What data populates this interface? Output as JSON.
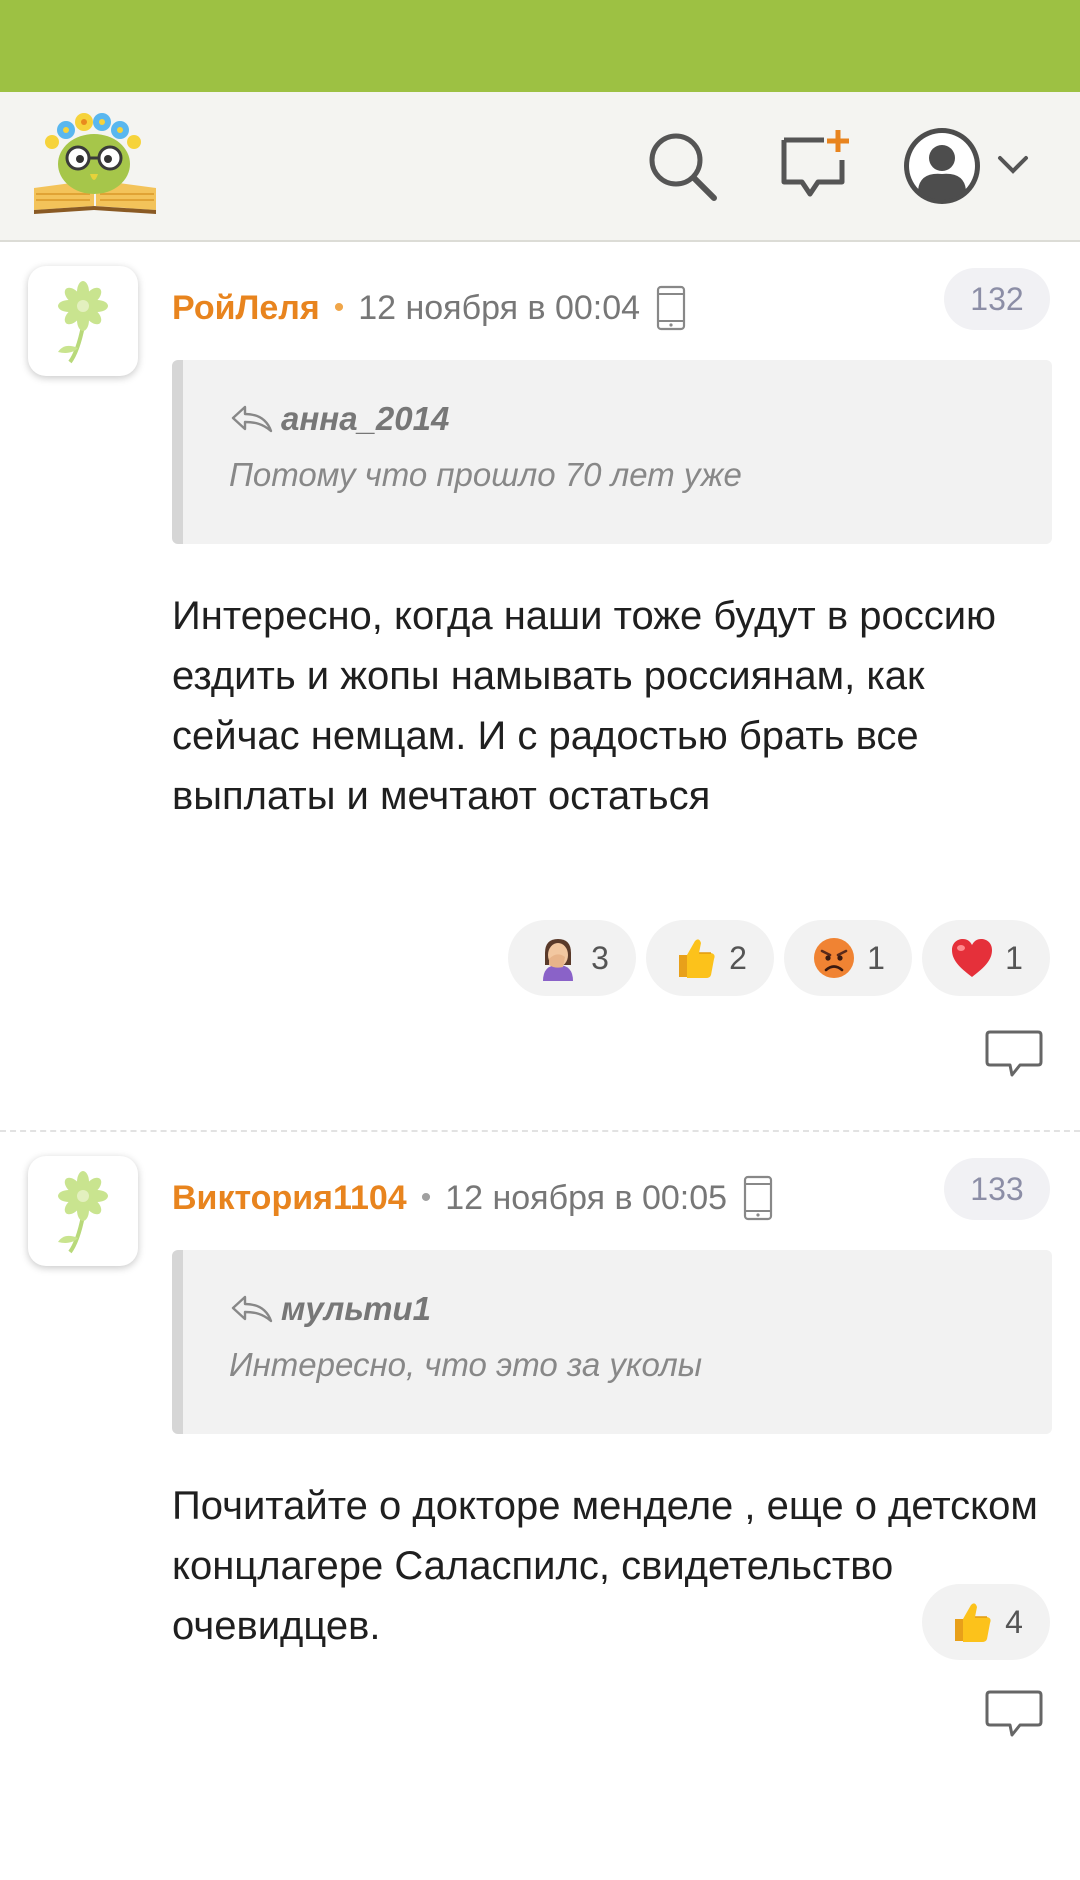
{
  "header": {
    "logo_name": "site-logo",
    "icons": [
      "search-icon",
      "new-message-icon",
      "user-avatar-icon",
      "chevron-down-icon"
    ]
  },
  "comments": [
    {
      "author": "РойЛеля",
      "separator": "•",
      "time": "12 ноября в 00:04",
      "number": "132",
      "quote": {
        "author": "анна_2014",
        "text": "Потому что прошло 70 лет уже"
      },
      "body": "Интересно, когда наши тоже будут в россию ездить и жопы намывать россиянам, как сейчас немцам. И с радостью брать все выплаты и мечтают остаться",
      "reactions": [
        {
          "emoji": "facepalm-emoji",
          "count": "3"
        },
        {
          "emoji": "thumbs-up-emoji",
          "count": "2"
        },
        {
          "emoji": "angry-face-emoji",
          "count": "1"
        },
        {
          "emoji": "red-heart-emoji",
          "count": "1"
        }
      ]
    },
    {
      "author": "Виктория1104",
      "separator": "•",
      "time": "12 ноября в 00:05",
      "number": "133",
      "quote": {
        "author": "мульти1",
        "text": "Интересно, что это за уколы"
      },
      "body": "Почитайте о докторе менделе , еще о детском концлагере Саласпилс, свидетельство очевидцев.",
      "reactions": [
        {
          "emoji": "thumbs-up-emoji",
          "count": "4"
        }
      ]
    }
  ],
  "colors": {
    "status_bar": "#9dc143",
    "username": "#e8841e",
    "header_bg": "#f4f4f1",
    "badge_text": "#8c8ea6"
  }
}
